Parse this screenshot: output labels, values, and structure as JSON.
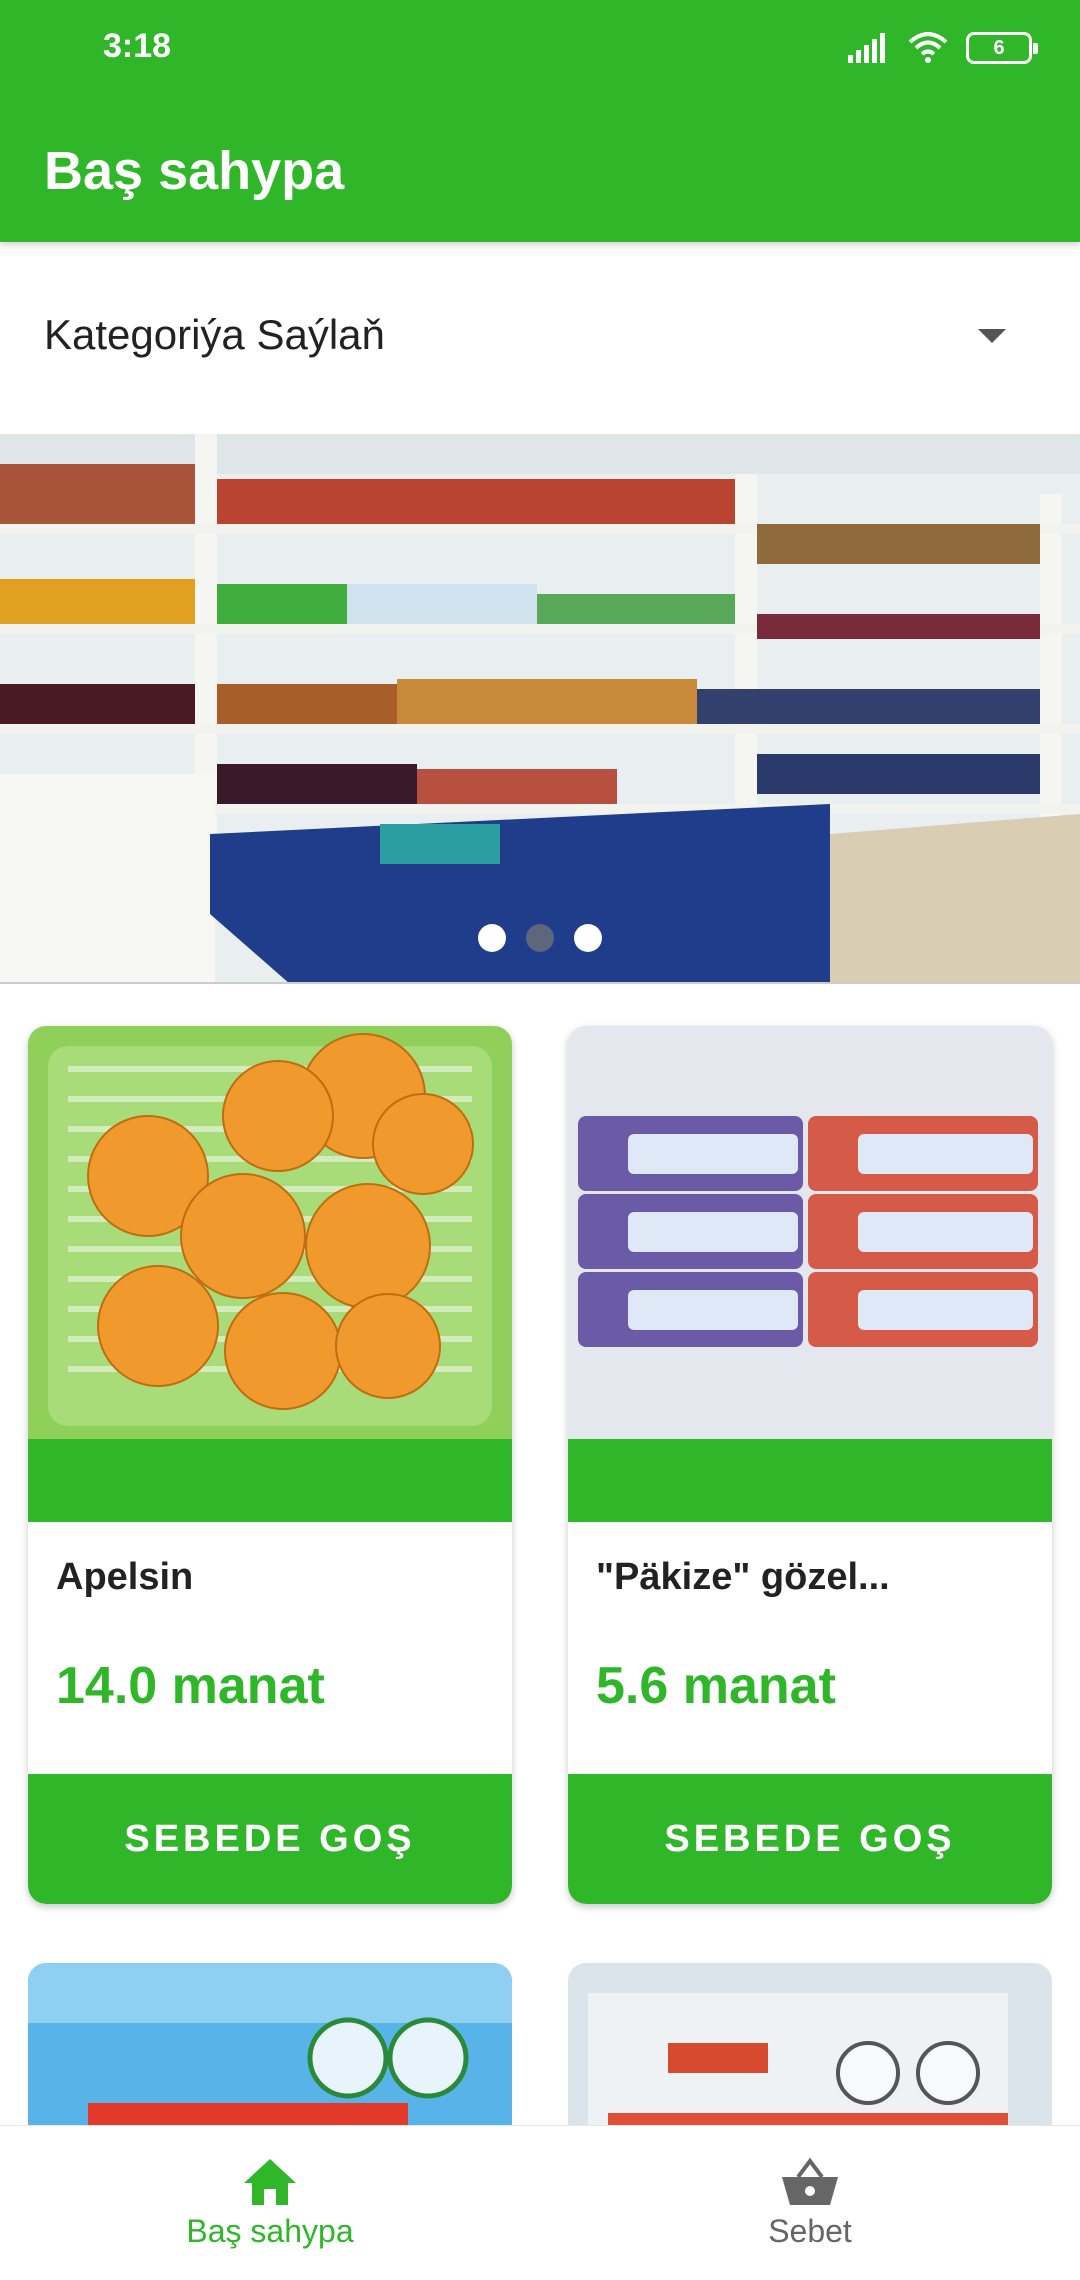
{
  "status_bar": {
    "time": "3:18",
    "battery": "6"
  },
  "app_bar": {
    "title": "Baş sahypa"
  },
  "category": {
    "label": "Kategoriýa Saýlaň"
  },
  "banner": {
    "dots": 3,
    "active_index": 1
  },
  "products": [
    {
      "name": "Apelsin",
      "price": "14.0 manat",
      "button": "SEBEDE GOŞ"
    },
    {
      "name": "\"Päkize\" gözel...",
      "price": "5.6 manat",
      "button": "SEBEDE GOŞ"
    }
  ],
  "bottom_nav": {
    "home": "Baş sahypa",
    "cart": "Sebet"
  },
  "colors": {
    "primary": "#2fb629"
  }
}
